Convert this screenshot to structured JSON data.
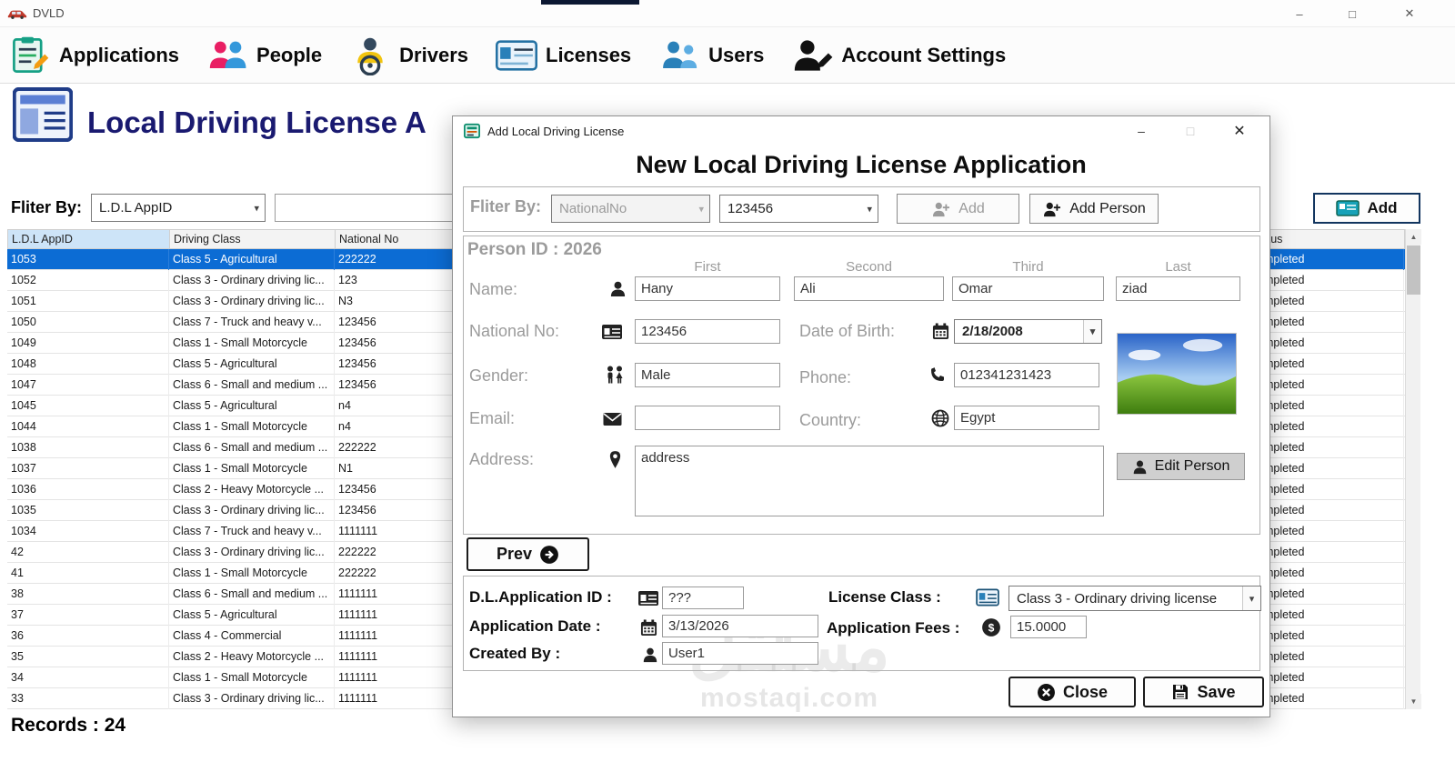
{
  "window": {
    "title": "DVLD",
    "minimize": "–",
    "maximize": "□",
    "close": "✕"
  },
  "toolbar": {
    "items": [
      {
        "label": "Applications",
        "icon": "applications-icon"
      },
      {
        "label": "People",
        "icon": "people-icon"
      },
      {
        "label": "Drivers",
        "icon": "drivers-icon"
      },
      {
        "label": "Licenses",
        "icon": "licenses-icon"
      },
      {
        "label": "Users",
        "icon": "users-icon"
      },
      {
        "label": "Account Settings",
        "icon": "account-settings-icon"
      }
    ]
  },
  "main": {
    "page_title": "Local Driving License A",
    "filter_label": "Fliter By:",
    "filter_dropdown_value": "L.D.L AppID",
    "filter_input_value": "",
    "add_button": "Add",
    "records": "Records : 24",
    "grid": {
      "columns": [
        "L.D.L AppID",
        "Driving Class",
        "National No",
        "Status"
      ],
      "rows": [
        {
          "app_id": "1053",
          "driving_class": "Class 5 - Agricultural",
          "national_no": "222222",
          "status": "Completed",
          "selected": true
        },
        {
          "app_id": "1052",
          "driving_class": "Class 3 - Ordinary driving lic...",
          "national_no": "123",
          "status": "Completed"
        },
        {
          "app_id": "1051",
          "driving_class": "Class 3 - Ordinary driving lic...",
          "national_no": "N3",
          "status": "Completed"
        },
        {
          "app_id": "1050",
          "driving_class": "Class 7 - Truck and heavy v...",
          "national_no": "123456",
          "status": "Completed"
        },
        {
          "app_id": "1049",
          "driving_class": "Class 1 - Small Motorcycle",
          "national_no": "123456",
          "status": "Completed"
        },
        {
          "app_id": "1048",
          "driving_class": "Class 5 - Agricultural",
          "national_no": "123456",
          "status": "Completed"
        },
        {
          "app_id": "1047",
          "driving_class": "Class 6 - Small and medium ...",
          "national_no": "123456",
          "status": "Completed"
        },
        {
          "app_id": "1045",
          "driving_class": "Class 5 - Agricultural",
          "national_no": "n4",
          "status": "Completed"
        },
        {
          "app_id": "1044",
          "driving_class": "Class 1 - Small Motorcycle",
          "national_no": "n4",
          "status": "Completed"
        },
        {
          "app_id": "1038",
          "driving_class": "Class 6 - Small and medium ...",
          "national_no": "222222",
          "status": "Completed"
        },
        {
          "app_id": "1037",
          "driving_class": "Class 1 - Small Motorcycle",
          "national_no": "N1",
          "status": "Completed"
        },
        {
          "app_id": "1036",
          "driving_class": "Class 2 - Heavy Motorcycle ...",
          "national_no": "123456",
          "status": "Completed"
        },
        {
          "app_id": "1035",
          "driving_class": "Class 3 - Ordinary driving lic...",
          "national_no": "123456",
          "status": "Completed"
        },
        {
          "app_id": "1034",
          "driving_class": "Class 7 - Truck and heavy v...",
          "national_no": "1111111",
          "status": "Completed"
        },
        {
          "app_id": "42",
          "driving_class": "Class 3 - Ordinary driving lic...",
          "national_no": "222222",
          "status": "Completed"
        },
        {
          "app_id": "41",
          "driving_class": "Class 1 - Small Motorcycle",
          "national_no": "222222",
          "status": "Completed"
        },
        {
          "app_id": "38",
          "driving_class": "Class 6 - Small and medium ...",
          "national_no": "1111111",
          "status": "Completed"
        },
        {
          "app_id": "37",
          "driving_class": "Class 5 - Agricultural",
          "national_no": "1111111",
          "status": "Completed"
        },
        {
          "app_id": "36",
          "driving_class": "Class 4 - Commercial",
          "national_no": "1111111",
          "status": "Completed"
        },
        {
          "app_id": "35",
          "driving_class": "Class 2 - Heavy Motorcycle ...",
          "national_no": "1111111",
          "status": "Completed"
        },
        {
          "app_id": "34",
          "driving_class": "Class 1 - Small Motorcycle",
          "national_no": "1111111",
          "status": "Completed"
        },
        {
          "app_id": "33",
          "driving_class": "Class 3 - Ordinary driving lic...",
          "national_no": "1111111",
          "status": "Completed"
        }
      ]
    }
  },
  "dialog": {
    "title": "Add Local Driving License",
    "minimize": "–",
    "maximize": "□",
    "close": "✕",
    "heading": "New Local Driving License Application",
    "filter": {
      "label": "Fliter By:",
      "mode": "NationalNo",
      "value": "123456",
      "add_button": "Add",
      "add_person_button": "Add Person"
    },
    "person": {
      "person_id": "Person ID : 2026",
      "name_headers": {
        "first": "First",
        "second": "Second",
        "third": "Third",
        "last": "Last"
      },
      "labels": {
        "name": "Name:",
        "national_no": "National No:",
        "dob": "Date of Birth:",
        "gender": "Gender:",
        "phone": "Phone:",
        "email": "Email:",
        "country": "Country:",
        "address": "Address:"
      },
      "values": {
        "first": "Hany",
        "second": "Ali",
        "third": "Omar",
        "last": "ziad",
        "national_no": "123456",
        "dob": "2/18/2008",
        "gender": "Male",
        "phone": "012341231423",
        "email": "",
        "country": "Egypt",
        "address": "address"
      },
      "edit_person_button": "Edit Person"
    },
    "prev_button": "Prev",
    "application": {
      "labels": {
        "app_id": "D.L.Application ID :",
        "license_class": "License Class :",
        "app_date": "Application Date :",
        "fees": "Application Fees :",
        "created_by": "Created By :"
      },
      "values": {
        "app_id": "???",
        "license_class": "Class 3 - Ordinary driving license",
        "app_date": "3/13/2026",
        "fees": "15.0000",
        "created_by": "User1"
      }
    },
    "close_button": "Close",
    "save_button": "Save",
    "watermark": {
      "arabic": "مستقل",
      "latin": "mostaqi.com"
    }
  }
}
